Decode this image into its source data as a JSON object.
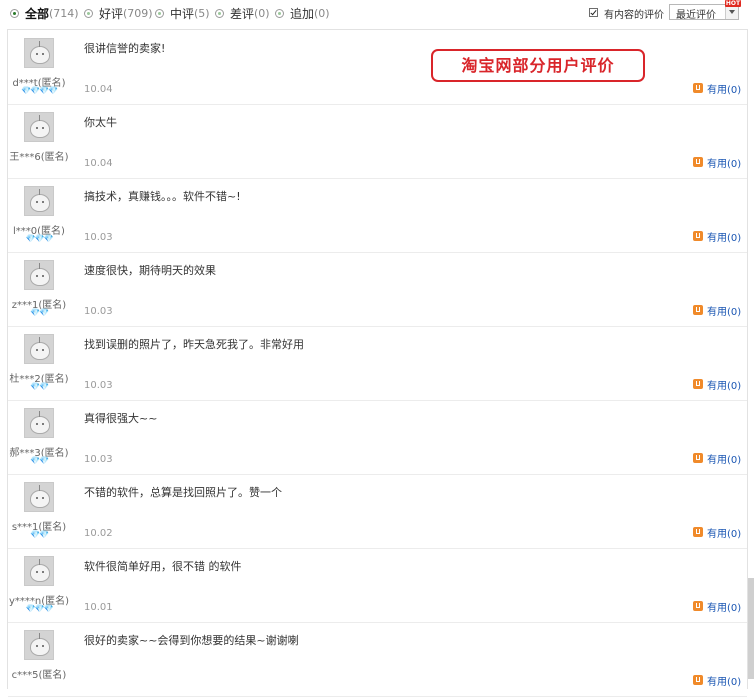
{
  "filters": [
    {
      "label": "全部",
      "count": "(714)",
      "selected": true
    },
    {
      "label": "好评",
      "count": "(709)",
      "selected": false
    },
    {
      "label": "中评",
      "count": "(5)",
      "selected": false
    },
    {
      "label": "差评",
      "count": "(0)",
      "selected": false
    },
    {
      "label": "追加",
      "count": "(0)",
      "selected": false
    }
  ],
  "content_filter": {
    "label": "有内容的评价",
    "checked": true
  },
  "sort": {
    "value": "最近评价",
    "badge": "HOT"
  },
  "watermark": "淘宝网部分用户评价",
  "reviews": [
    {
      "user": "d***t(匿名)",
      "gems": "💎💎💎💎",
      "text": "很讲信誉的卖家!",
      "date": "10.04",
      "useful": "有用(0)"
    },
    {
      "user": "王***6(匿名)",
      "gems": "",
      "text": "你太牛",
      "date": "10.04",
      "useful": "有用(0)"
    },
    {
      "user": "l***0(匿名)",
      "gems": "💎💎💎",
      "text": "搞技术，真赚钱。。。软件不错~!",
      "date": "10.03",
      "useful": "有用(0)"
    },
    {
      "user": "z***1(匿名)",
      "gems": "💎💎",
      "text": "速度很快，期待明天的效果",
      "date": "10.03",
      "useful": "有用(0)"
    },
    {
      "user": "杜***2(匿名)",
      "gems": "💎💎",
      "text": "找到误删的照片了，昨天急死我了。非常好用",
      "date": "10.03",
      "useful": "有用(0)"
    },
    {
      "user": "郝***3(匿名)",
      "gems": "💎💎",
      "text": "真得很强大~~",
      "date": "10.03",
      "useful": "有用(0)"
    },
    {
      "user": "s***1(匿名)",
      "gems": "💎💎",
      "text": "不错的软件，总算是找回照片了。赞一个",
      "date": "10.02",
      "useful": "有用(0)"
    },
    {
      "user": "y****n(匿名)",
      "gems": "💎💎💎",
      "text": "软件很简单好用，很不错 的软件",
      "date": "10.01",
      "useful": "有用(0)"
    },
    {
      "user": "c***5(匿名)",
      "gems": "",
      "text": "很好的卖家~~会得到你想要的结果~谢谢喇",
      "date": "",
      "useful": "有用(0)"
    }
  ]
}
